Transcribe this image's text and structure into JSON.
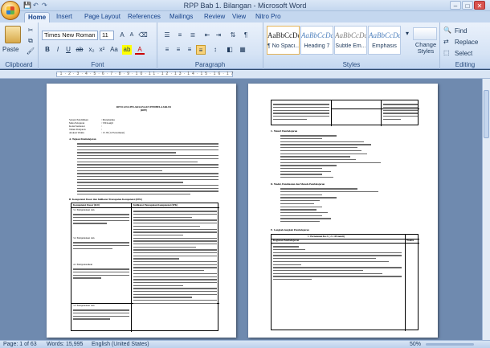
{
  "window": {
    "title": "RPP Bab 1. Bilangan - Microsoft Word"
  },
  "quick_access": [
    "save-icon",
    "undo-icon",
    "redo-icon"
  ],
  "window_controls": [
    "minimize-icon",
    "maximize-icon",
    "close-icon"
  ],
  "tabs": [
    "Home",
    "Insert",
    "Page Layout",
    "References",
    "Mailings",
    "Review",
    "View",
    "Nitro Pro"
  ],
  "ribbon": {
    "clipboard": {
      "label": "Clipboard",
      "paste": "Paste"
    },
    "font": {
      "label": "Font",
      "name": "Times New Roman",
      "size": "11"
    },
    "paragraph": {
      "label": "Paragraph"
    },
    "styles": {
      "label": "Styles",
      "items": [
        {
          "sample": "AaBbCcDc",
          "name": "¶ No Spaci..."
        },
        {
          "sample": "AaBbCcDc",
          "name": "Heading 7"
        },
        {
          "sample": "AaBbCcDc",
          "name": "Subtle Em..."
        },
        {
          "sample": "AaBbCcDc",
          "name": "Emphasis"
        }
      ],
      "change_styles": "Change Styles"
    },
    "editing": {
      "label": "Editing",
      "find": "Find",
      "replace": "Replace",
      "select": "Select"
    }
  },
  "document": {
    "page1": {
      "title_line1": "RENCANA PELAKSANAAN PEMBELAJARAN",
      "title_line2": "(RPP)",
      "info": [
        [
          "Satuan Pendidikan",
          ": Matematika"
        ],
        [
          "Mata Pelajaran",
          ": VII/Ganjil"
        ],
        [
          "Kelas/Semester",
          ":"
        ],
        [
          "Tahun Pelajaran",
          ":"
        ],
        [
          "Alokasi Waktu",
          ": 15 JP (12 Pertemuan)"
        ]
      ],
      "section_a": "A.  Tujuan Pembelajaran",
      "section_b": "B.  Kompetensi Dasar dan Indikator Pencapaian Kompetensi (IPK)",
      "table_head": [
        "Kompetensi Dasar (KD)",
        "Indikator Pencapaian Kompetensi (IPK)"
      ],
      "kd_rows": [
        "3.1 Menjelaskan dan",
        "3.2 Menjelaskan dan",
        "4.1 Menyelesaikan",
        "3.3 Menjelaskan dan"
      ]
    },
    "page2": {
      "section_c": "C.  Materi Pembelajaran",
      "section_d": "D.  Model, Pendekatan dan Metode Pembelajaran",
      "section_e": "E.  Langkah-langkah Pembelajaran",
      "meeting": "1. Pertemuan Ke-1 ( 2 x 40 menit)",
      "activity_head": [
        "Kegiatan Pembelajaran",
        "Waktu"
      ]
    }
  },
  "status": {
    "page": "Page: 1 of 63",
    "words": "Words: 15,995",
    "language": "English (United States)",
    "zoom": "50%"
  }
}
